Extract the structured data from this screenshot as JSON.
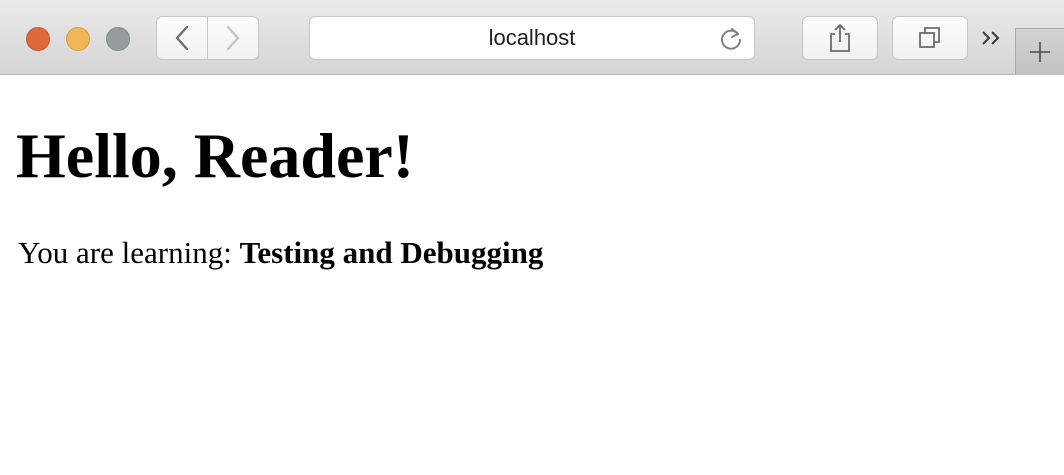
{
  "browser": {
    "address": "localhost"
  },
  "page": {
    "heading": "Hello, Reader!",
    "learning_prefix": "You are learning: ",
    "topic": "Testing and Debugging"
  },
  "colors": {
    "close": "#e0683d",
    "minimize": "#f0b758",
    "zoom": "#959c9b"
  },
  "icons": [
    "chevron-left-icon",
    "chevron-right-icon",
    "reload-icon",
    "share-icon",
    "tabs-icon",
    "double-chevron-right-icon",
    "plus-icon"
  ]
}
